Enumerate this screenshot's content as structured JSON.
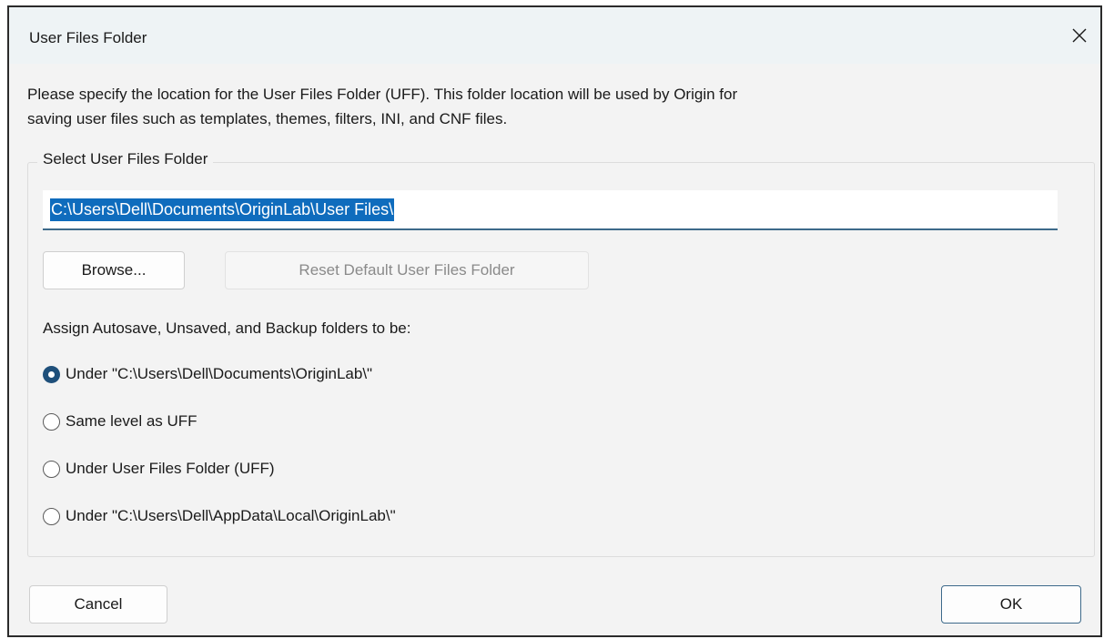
{
  "window": {
    "title": "User Files Folder",
    "close_icon": "close-icon"
  },
  "description": {
    "line1": "Please specify the location for the User Files Folder (UFF). This folder location will be used by Origin for",
    "line2": "saving user files such as templates, themes, filters, INI, and CNF files."
  },
  "uff_group": {
    "legend": "Select User Files Folder",
    "path_value": "C:\\Users\\Dell\\Documents\\OriginLab\\User Files\\",
    "browse_label": "Browse...",
    "reset_label": "Reset Default User Files Folder",
    "assign_label": "Assign Autosave, Unsaved, and Backup folders to be:",
    "options": [
      {
        "label": "Under \"C:\\Users\\Dell\\Documents\\OriginLab\\\"",
        "checked": true
      },
      {
        "label": "Same level as UFF",
        "checked": false
      },
      {
        "label": "Under User Files Folder (UFF)",
        "checked": false
      },
      {
        "label": "Under \"C:\\Users\\Dell\\AppData\\Local\\OriginLab\\\"",
        "checked": false
      }
    ]
  },
  "footer": {
    "cancel_label": "Cancel",
    "ok_label": "OK"
  },
  "colors": {
    "selection": "#0f6cbd",
    "radio_checked": "#1e4f7a",
    "input_underline": "#3d6a8a"
  }
}
